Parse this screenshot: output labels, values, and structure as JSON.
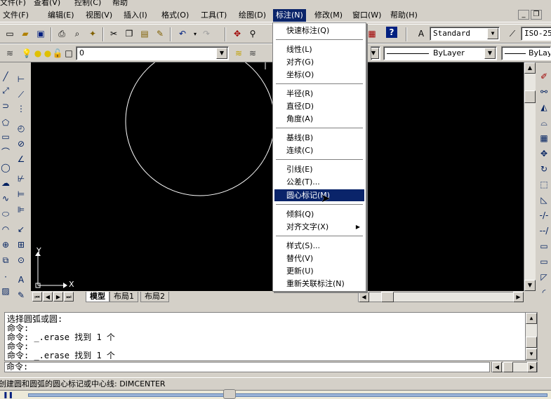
{
  "top_menu": [
    "文件(F)",
    "查看(V)",
    "控制(C)",
    "帮助"
  ],
  "menubar": {
    "items": [
      "文件(F)",
      "编辑(E)",
      "视图(V)",
      "插入(I)",
      "格式(O)",
      "工具(T)",
      "绘图(D)",
      "标注(N)",
      "修改(M)",
      "窗口(W)",
      "帮助(H)"
    ],
    "active": "标注(N)",
    "minimize": "_",
    "restore": "❐"
  },
  "toolbar": {
    "text_style": "Standard",
    "dim_style": "ISO-25",
    "layer": "0",
    "linetype": "ByLayer",
    "lineweight": "ByLay"
  },
  "dimension_menu": {
    "groups": [
      [
        "快速标注(Q)"
      ],
      [
        "线性(L)",
        "对齐(G)",
        "坐标(O)"
      ],
      [
        "半径(R)",
        "直径(D)",
        "角度(A)"
      ],
      [
        "基线(B)",
        "连续(C)"
      ],
      [
        "引线(E)",
        "公差(T)...",
        "圆心标记(M)"
      ],
      [
        "倾斜(Q)",
        "对齐文字(X)"
      ],
      [
        "样式(S)...",
        "替代(V)",
        "更新(U)",
        "重新关联标注(N)"
      ]
    ],
    "highlighted": "圆心标记(M)",
    "submenu_item": "对齐文字(X)",
    "submenu_arrow": "▶"
  },
  "layout_tabs": [
    "模型",
    "布局1",
    "布局2"
  ],
  "ucs": {
    "x": "X",
    "y": "Y"
  },
  "command_history": [
    "选择圆弧或圆:",
    "命令:",
    "命令: _.erase 找到 1 个",
    "命令:",
    "命令: _.erase 找到 1 个"
  ],
  "command_prompt": "命令:",
  "status_text": "创建圆和圆弧的圆心标记或中心线:  DIMCENTER"
}
